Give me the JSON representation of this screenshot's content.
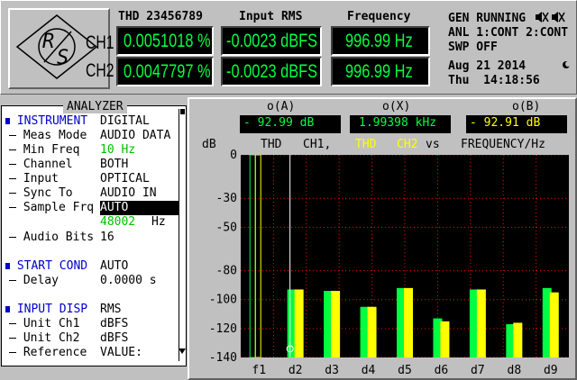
{
  "header": {
    "thd_title": "THD 23456789",
    "rms_title": "Input RMS",
    "freq_title": "Frequency",
    "ch1_label": "CH1",
    "ch2_label": "CH2",
    "ch1_thd": "0.0051018 %",
    "ch2_thd": "0.0047797 %",
    "ch1_rms": "-0.0023 dBFS",
    "ch2_rms": "-0.0023 dBFS",
    "ch1_freq": "996.99 Hz",
    "ch2_freq": "996.99 Hz",
    "gen_status": "GEN RUNNING",
    "anl_status": "ANL 1:CONT 2:CONT",
    "swp_status": "SWP OFF",
    "date": "Aug 21 2014",
    "time": "Thu  14:18:56"
  },
  "analyzer": {
    "title": "ANALYZER",
    "instrument_label": "INSTRUMENT",
    "instrument_value": "DIGITAL",
    "meas_mode_label": "Meas Mode",
    "meas_mode_value": "AUDIO DATA",
    "min_freq_label": "Min Freq",
    "min_freq_value": "10 Hz",
    "channel_label": "Channel",
    "channel_value": "BOTH",
    "input_label": "Input",
    "input_value": "OPTICAL",
    "sync_label": "Sync To",
    "sync_value": "AUDIO IN",
    "sample_label": "Sample Frq",
    "sample_value": "AUTO",
    "sample_rate": "48002",
    "sample_unit": "Hz",
    "bits_label": "Audio Bits",
    "bits_value": "16",
    "start_label": "START COND",
    "start_value": "AUTO",
    "delay_label": "Delay",
    "delay_value": "0.0000 s",
    "input_disp_label": "INPUT DISP",
    "input_disp_value": "RMS",
    "unit1_label": "Unit Ch1",
    "unit1_value": "dBFS",
    "unit2_label": "Unit Ch2",
    "unit2_value": "dBFS",
    "ref_label": "Reference",
    "ref_value": "VALUE:"
  },
  "graph": {
    "cursor_a_label": "o(A)",
    "cursor_x_label": "o(X)",
    "cursor_b_label": "o(B)",
    "cursor_a_value": "- 92.99 dB",
    "cursor_x_value": "1.99398 kHz",
    "cursor_b_value": "- 92.91 dB",
    "unit_label": "dB",
    "legend_thd": "THD",
    "legend_ch1": "CH1,",
    "legend_thd2": "THD",
    "legend_ch2": "CH2",
    "legend_vs": "vs",
    "legend_xunit": "FREQUENCY/Hz"
  },
  "colors": {
    "ch1": "#00ff40",
    "ch2": "#ffff00",
    "grid": "#ff0000",
    "accent": "#0000c8"
  },
  "chart_data": {
    "type": "bar",
    "categories": [
      "f1",
      "d2",
      "d3",
      "d4",
      "d5",
      "d6",
      "d7",
      "d8",
      "d9"
    ],
    "series": [
      {
        "name": "CH1",
        "values": [
          0,
          -93,
          -94,
          -105,
          -92,
          -113,
          -93,
          -117,
          -92
        ]
      },
      {
        "name": "CH2",
        "values": [
          0,
          -93,
          -94,
          -105,
          -92,
          -115,
          -93,
          -116,
          -95
        ]
      }
    ],
    "ylim": [
      -140,
      0
    ],
    "yticks": [
      0,
      -30,
      -50,
      -80,
      -100,
      -120,
      -140
    ],
    "ylabel": "dB",
    "grid": true
  }
}
